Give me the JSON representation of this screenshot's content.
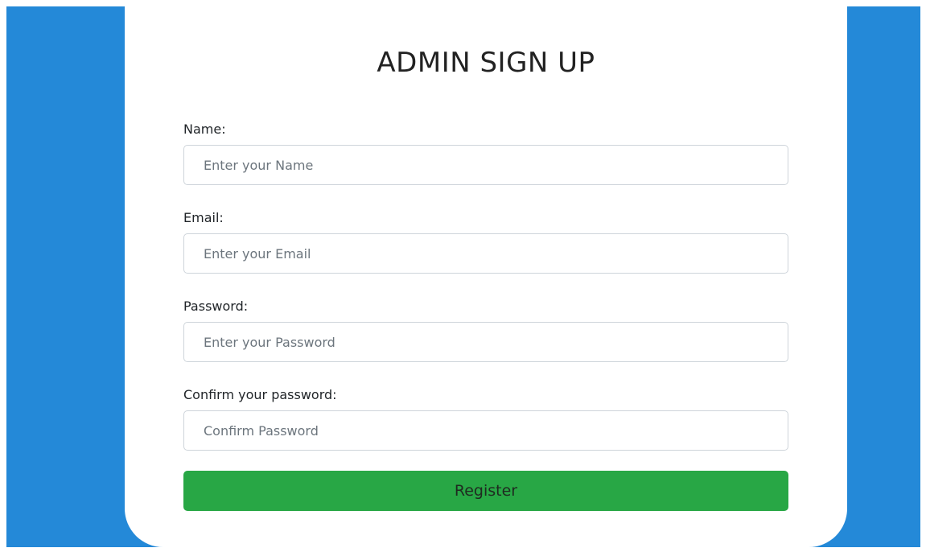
{
  "form": {
    "title": "ADMIN SIGN UP",
    "fields": [
      {
        "label": "Name:",
        "placeholder": "Enter your Name",
        "value": ""
      },
      {
        "label": "Email:",
        "placeholder": "Enter your Email",
        "value": ""
      },
      {
        "label": "Password:",
        "placeholder": "Enter your Password",
        "value": ""
      },
      {
        "label": "Confirm your password:",
        "placeholder": "Confirm Password",
        "value": ""
      }
    ],
    "submit_label": "Register"
  },
  "colors": {
    "background": "#2489d8",
    "card": "#ffffff",
    "button": "#28a745"
  }
}
